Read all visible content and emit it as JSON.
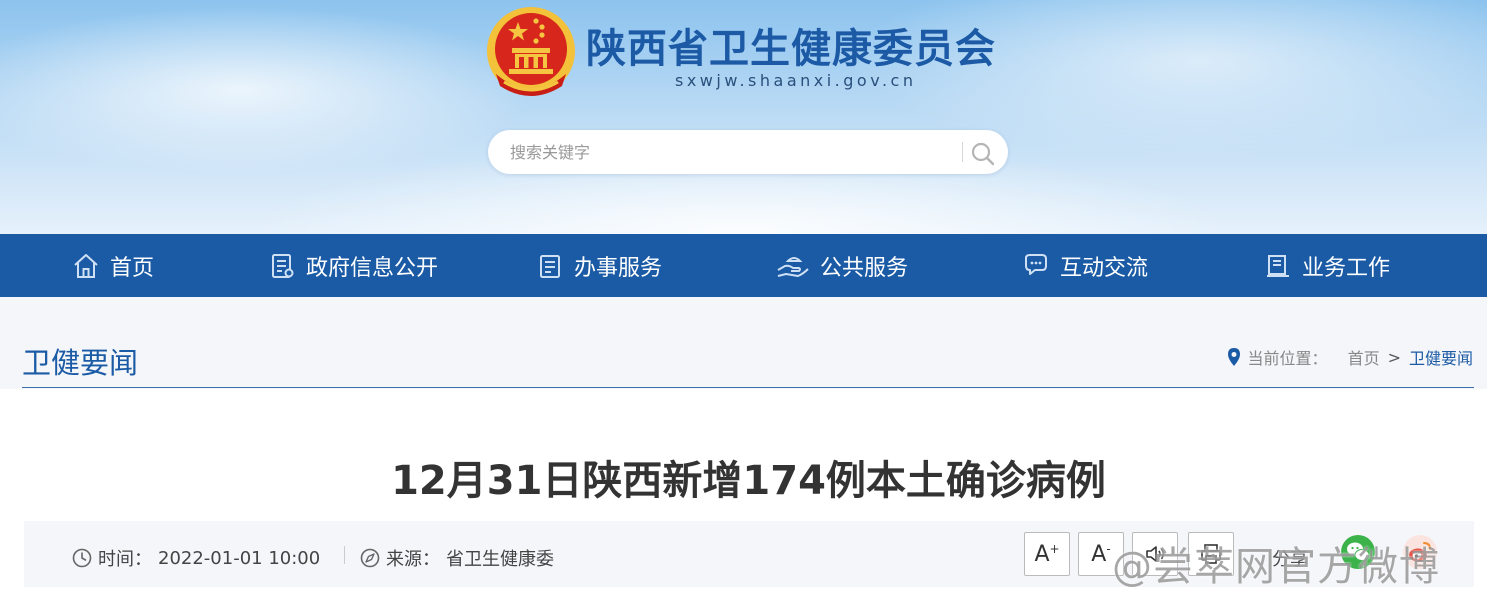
{
  "header": {
    "site_title": "陕西省卫生健康委员会",
    "site_url": "sxwjw.shaanxi.gov.cn",
    "search_placeholder": "搜索关键字"
  },
  "nav": {
    "items": [
      {
        "label": "首页",
        "icon": "home-icon"
      },
      {
        "label": "政府信息公开",
        "icon": "document-list-icon"
      },
      {
        "label": "办事服务",
        "icon": "clipboard-icon"
      },
      {
        "label": "公共服务",
        "icon": "hand-service-icon"
      },
      {
        "label": "互动交流",
        "icon": "chat-bubbles-icon"
      },
      {
        "label": "业务工作",
        "icon": "briefcase-icon"
      }
    ]
  },
  "section": {
    "title": "卫健要闻"
  },
  "breadcrumb": {
    "prefix": "当前位置：",
    "home": "首页",
    "separator": ">",
    "current": "卫健要闻"
  },
  "article": {
    "title": "12月31日陕西新增174例本土确诊病例",
    "time_label": "时间：",
    "time_value": "2022-01-01 10:00",
    "source_label": "来源：",
    "source_value": "省卫生健康委"
  },
  "tools": {
    "font_increase": "A",
    "font_increase_sup": "+",
    "font_decrease": "A",
    "font_decrease_sup": "-",
    "share_label": "分享"
  },
  "watermark": "@尝萃网官方微博",
  "colors": {
    "brand_blue": "#1b5ba5",
    "section_bg": "#f5f6fa",
    "emblem_red": "#d7261c",
    "emblem_gold": "#f5c542",
    "wechat_green": "#3bb24a",
    "weibo_red": "#e24a3b"
  }
}
